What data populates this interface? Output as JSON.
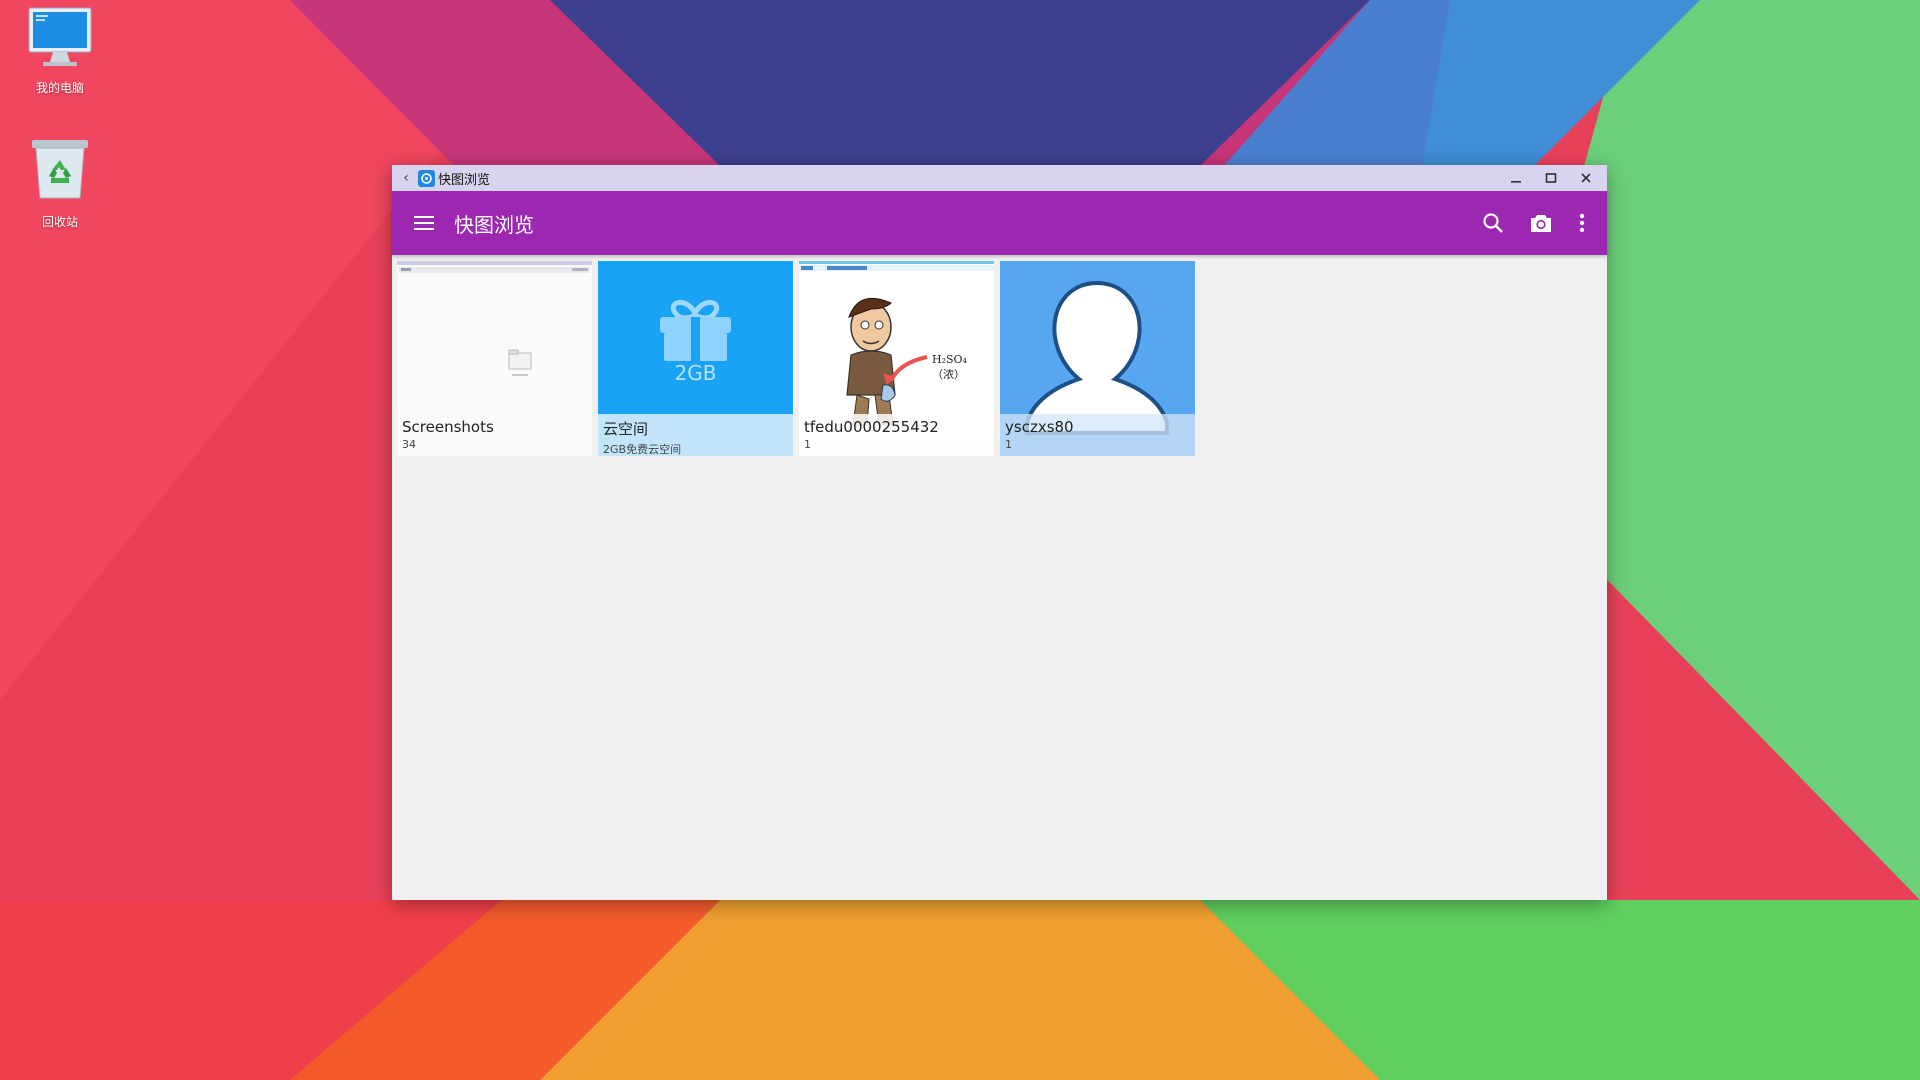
{
  "desktop": {
    "icons": [
      {
        "label": "我的电脑",
        "icon": "computer-icon"
      },
      {
        "label": "回收站",
        "icon": "recycle-bin-icon"
      }
    ]
  },
  "window": {
    "title": "快图浏览",
    "controls": [
      "minimize-icon",
      "maximize-icon",
      "close-icon"
    ]
  },
  "appbar": {
    "title": "快图浏览",
    "color": "#9c27b0",
    "actions": [
      "search-icon",
      "camera-icon",
      "more-vert-icon"
    ]
  },
  "albums": [
    {
      "title": "Screenshots",
      "subtitle": "34"
    },
    {
      "title": "云空间",
      "subtitle": "2GB免费云空间",
      "badge": "2GB",
      "color": "#1aa3f5"
    },
    {
      "title": "tfedu0000255432",
      "subtitle": "1",
      "thumb_text": "H₂SO₄（浓）"
    },
    {
      "title": "ysczxs80",
      "subtitle": "1",
      "color": "#57a6f0"
    }
  ]
}
